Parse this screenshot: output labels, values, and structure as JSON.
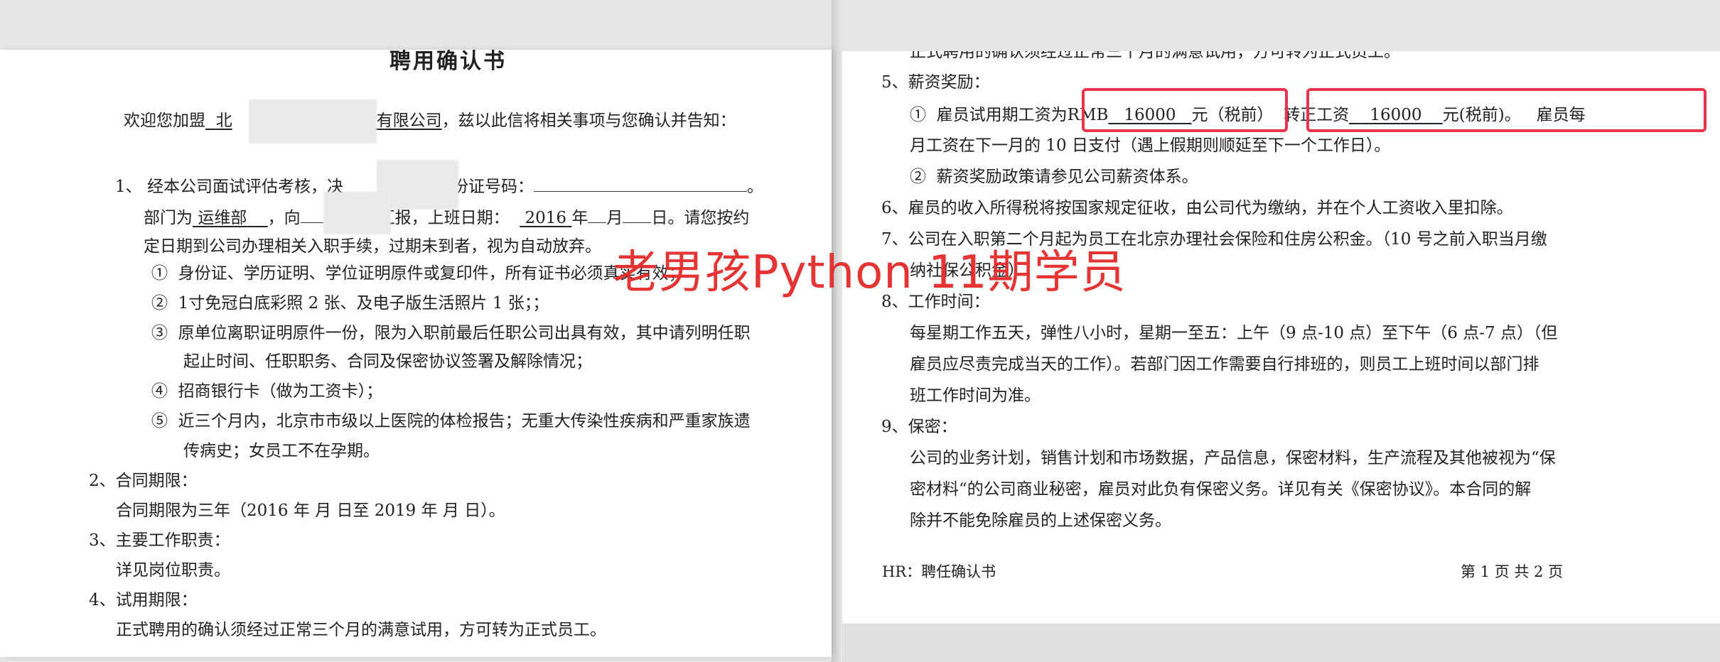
{
  "left": {
    "title": "聘用确认书",
    "welcome_prefix": "欢迎您加盟",
    "company_start": "北",
    "company_end": "技有限公司",
    "welcome_suffix": "，兹以此信将相关事项与您确认并告知：",
    "item1_a": "1、 经本公司面试评估考核，决",
    "item1_b": "身份证号码：",
    "item1_c": "。",
    "dept_prefix": "部门为",
    "dept": "运维部",
    "report_prefix": "，向",
    "report_suffix": "汇报，上班日期：",
    "start_year": "2016",
    "year_unit": "年",
    "month_unit": "月",
    "day_unit": "日。请您按约",
    "line3": "定日期到公司办理相关入职手续，过期未到者，视为自动放弃。",
    "docs": [
      {
        "num": "①",
        "text": "身份证、学历证明、学位证明原件或复印件，所有证书必须真实有效；"
      },
      {
        "num": "②",
        "text": "1寸免冠白底彩照 2 张、及电子版生活照片 1 张；；"
      },
      {
        "num": "③",
        "text": "原单位离职证明原件一份，限为入职前最后任职公司出具有效，其中请列明任职"
      },
      {
        "num": "",
        "text": "起止时间、任职职务、合同及保密协议签署及解除情况；"
      },
      {
        "num": "④",
        "text": "招商银行卡（做为工资卡）；"
      },
      {
        "num": "⑤",
        "text": "近三个月内，北京市市级以上医院的体检报告；无重大传染性疾病和严重家族遗"
      },
      {
        "num": "",
        "text": "传病史；女员工不在孕期。"
      }
    ],
    "s2_title": "2、合同期限：",
    "s2_body": "合同期限为三年（2016 年    月    日至 2019 年  月   日）。",
    "s3_title": "3、主要工作职责：",
    "s3_body": "详见岗位职责。",
    "s4_title": "4、试用期限：",
    "s4_body": "正式聘用的确认须经过正常三个月的满意试用，方可转为正式员工。"
  },
  "right": {
    "top_partial": "正式聘用的确认须经过正常三个月的满意试用，方可转为正式员工。",
    "s5_title": "5、薪资奖励：",
    "s5_1_num": "①",
    "s5_1_a": "雇员试用期工资为",
    "s5_1_rmb": "RMB",
    "trial_salary": "16000",
    "s5_1_unit1": "元（税前）",
    "s5_1_b": "转正工资",
    "regular_salary": "16000",
    "s5_1_unit2": "元(税前)。",
    "s5_1_c": "雇员每",
    "s5_1_line2": "月工资在下一月的 10 日支付（遇上假期则顺延至下一个工作日）。",
    "s5_2_num": "②",
    "s5_2": "薪资奖励政策请参见公司薪资体系。",
    "s6": "6、雇员的收入所得税将按国家规定征收，由公司代为缴纳，并在个人工资收入里扣除。",
    "s7_a": "7、公司在入职第二个月起为员工在北京办理社会保险和住房公积金。（10 号之前入职当月缴",
    "s7_b": "纳社保公积金）",
    "s8_title": "8、工作时间：",
    "s8_l1": "每星期工作五天，弹性八小时，星期一至五：上午（9 点-10 点）至下午（6 点-7 点）（但",
    "s8_l2": "雇员应尽责完成当天的工作）。若部门因工作需要自行排班的，则员工上班时间以部门排",
    "s8_l3": "班工作时间为准。",
    "s9_title": "9、保密：",
    "s9_l1": "公司的业务计划，销售计划和市场数据，产品信息，保密材料，生产流程及其他被视为“保",
    "s9_l2": "密材料“的公司商业秘密，雇员对此负有保密义务。详见有关《保密协议》。本合同的解",
    "s9_l3": "除并不能免除雇员的上述保密义务。",
    "footer_left": "HR：聘任确认书",
    "footer_right": "第 1 页  共 2 页"
  },
  "watermark": "老男孩Python 11期学员",
  "colors": {
    "highlight_box": "#e8334a",
    "watermark": "#e42a2a"
  }
}
